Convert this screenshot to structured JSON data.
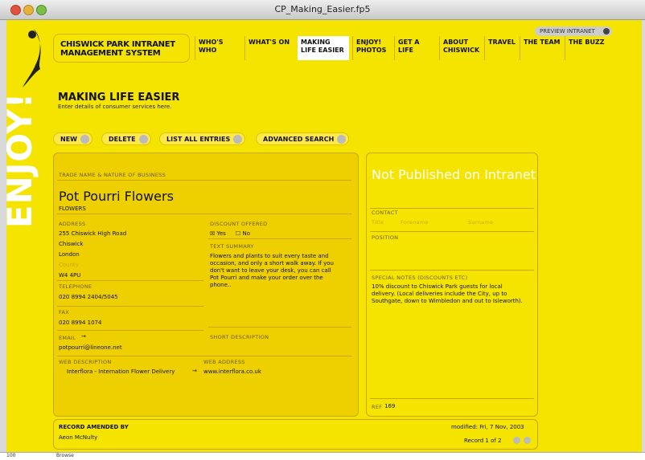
{
  "window": {
    "title": "CP_Making_Easier.fp5"
  },
  "brand": {
    "logo_text": "ENJOY!",
    "system_title": "CHISWICK PARK INTRANET MANAGEMENT SYSTEM"
  },
  "header": {
    "preview_label": "PREVIEW INTRANET"
  },
  "nav": [
    "WHO'S WHO",
    "WHAT'S ON",
    "MAKING LIFE EASIER",
    "ENJOY! PHOTOS",
    "GET A LIFE",
    "ABOUT CHISWICK",
    "TRAVEL",
    "THE TEAM",
    "THE BUZZ"
  ],
  "page": {
    "title": "MAKING LIFE EASIER",
    "subtitle": "Enter details of consumer services here."
  },
  "toolbar": {
    "new": "NEW",
    "delete": "DELETE",
    "list": "LIST ALL ENTRIES",
    "search": "ADVANCED SEARCH"
  },
  "record": {
    "trade_label": "TRADE NAME & NATURE OF BUSINESS",
    "trade_name": "Pot Pourri Flowers",
    "nature": "FLOWERS",
    "address_label": "ADDRESS",
    "address1": "255 Chiswick High Road",
    "address2": "Chiswick",
    "address3": "London",
    "county_placeholder": "County",
    "postcode": "W4 4PU",
    "telephone_label": "TELEPHONE",
    "telephone": "020 8994 2404/5045",
    "fax_label": "FAX",
    "fax": "020 8994 1074",
    "email_label": "EMAIL",
    "email": "potpourri@lineone.net",
    "web_desc_label": "WEB DESCRIPTION",
    "web_desc": "Interflora - Internation Flower Delivery",
    "web_addr_label": "WEB ADDRESS",
    "web_addr": "www.interflora.co.uk",
    "discount_label": "DISCOUNT OFFERED",
    "yes": "Yes",
    "no": "No",
    "text_summary_label": "TEXT SUMMARY",
    "text_summary": "Flowers and plants to suit every taste and occasion, and only a short walk away.  If you don't want to leave your desk, you can call Pot Pourri and make your order over the phone..",
    "short_desc_label": "SHORT DESCRIPTION"
  },
  "side": {
    "status": "Not Published on Intranet",
    "contact_label": "CONTACT",
    "title_ph": "Title",
    "forename_ph": "Forename",
    "surname_ph": "Surname",
    "position_label": "POSITION",
    "notes_label": "SPECIAL NOTES (DISCOUNTS ETC)",
    "notes": "10% discount to Chiswick Park guests for local delivery.  (Local deliveries include the City, up to Southgate, down to Wimbledon and out to Isleworth).",
    "ref_label": "REF",
    "ref": "169"
  },
  "footer": {
    "amended_label": "RECORD AMENDED BY",
    "amended_by": "Aeon McNulty",
    "modified": "modified: Fri, 7 Nov, 2003",
    "record_count": "Record 1 of 2"
  },
  "statusbar": {
    "zoom": "100",
    "mode": "Browse"
  }
}
